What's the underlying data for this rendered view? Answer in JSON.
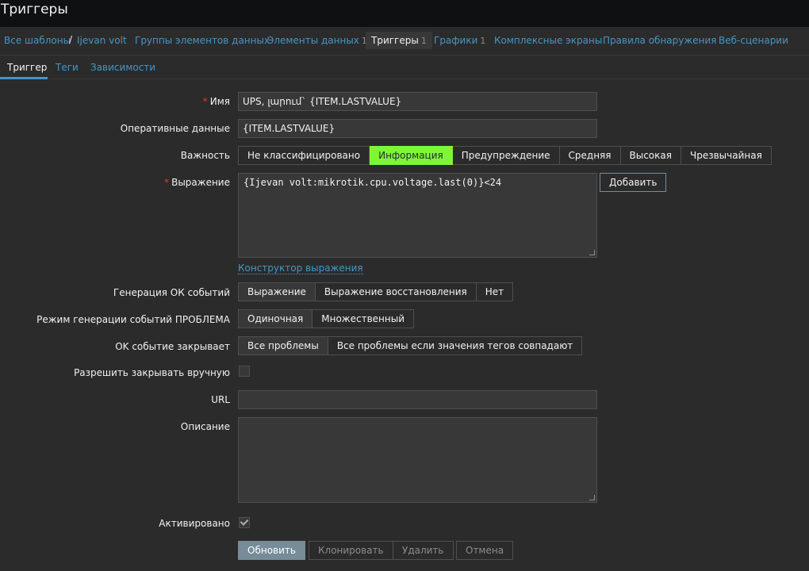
{
  "title": "Триггеры",
  "breadcrumb": {
    "all_templates": "Все шаблоны",
    "separator": "/",
    "host": "Ijevan volt"
  },
  "nav": {
    "item_groups": "Группы элементов данных",
    "items": {
      "label": "Элементы данных",
      "count": "1"
    },
    "triggers": {
      "label": "Триггеры",
      "count": "1"
    },
    "graphs": {
      "label": "Графики",
      "count": "1"
    },
    "screens": "Комплексные экраны",
    "discovery": "Правила обнаружения",
    "web": "Веб-сценарии"
  },
  "subtabs": {
    "trigger": "Триггер",
    "tags": "Теги",
    "dependencies": "Зависимости"
  },
  "form": {
    "name": {
      "label": "Имя",
      "required_mark": "*",
      "value": "UPS, լարում` {ITEM.LASTVALUE}"
    },
    "opdata": {
      "label": "Оперативные данные",
      "value": "{ITEM.LASTVALUE}"
    },
    "severity": {
      "label": "Важность",
      "options": [
        "Не классифицировано",
        "Информация",
        "Предупреждение",
        "Средняя",
        "Высокая",
        "Чрезвычайная"
      ],
      "selected": "Информация",
      "selected_color": "#7ef536"
    },
    "expression": {
      "label": "Выражение",
      "required_mark": "*",
      "value": "{Ijevan volt:mikrotik.cpu.voltage.last(0)}<24",
      "add_button": "Добавить",
      "constructor_link": "Конструктор выражения"
    },
    "ok_event_generation": {
      "label": "Генерация ОК событий",
      "options": [
        "Выражение",
        "Выражение восстановления",
        "Нет"
      ],
      "selected": "Выражение"
    },
    "problem_mode": {
      "label": "Режим генерации событий ПРОБЛЕМА",
      "options": [
        "Одиночная",
        "Множественный"
      ],
      "selected": "Одиночная"
    },
    "ok_closes": {
      "label": "OK событие закрывает",
      "options": [
        "Все проблемы",
        "Все проблемы если значения тегов совпадают"
      ],
      "selected": "Все проблемы"
    },
    "manual_close": {
      "label": "Разрешить закрывать вручную",
      "checked": false
    },
    "url": {
      "label": "URL",
      "value": ""
    },
    "description": {
      "label": "Описание",
      "value": ""
    },
    "enabled": {
      "label": "Активировано",
      "checked": true
    }
  },
  "actions": {
    "update": "Обновить",
    "clone": "Клонировать",
    "delete": "Удалить",
    "cancel": "Отмена"
  }
}
